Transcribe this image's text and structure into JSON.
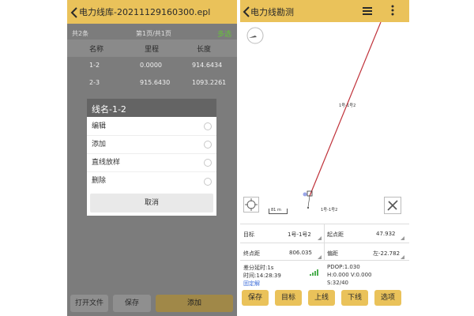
{
  "left": {
    "title": "电力线库-20211129160300.epl",
    "back_icon": "back-arrow-icon",
    "count_text": "共2条",
    "page_text": "第1页/共1页",
    "multi_select": "多选",
    "table": {
      "headers": [
        "名称",
        "里程",
        "长度"
      ],
      "rows": [
        [
          "1-2",
          "0.0000",
          "914.6434"
        ],
        [
          "2-3",
          "915.6430",
          "1093.2261"
        ]
      ]
    },
    "dialog": {
      "title": "线名-1-2",
      "options": [
        "编辑",
        "添加",
        "直线放样",
        "删除"
      ],
      "cancel": "取消"
    },
    "footer": {
      "open_file": "打开文件",
      "save": "保存",
      "add": "添加"
    }
  },
  "right": {
    "title": "电力线勘测",
    "icons": {
      "back": "back-arrow-icon",
      "layers": "layers-menu-icon",
      "more": "more-vertical-icon",
      "compass": "compass-icon",
      "locate": "locate-target-icon",
      "tools": "tools-icon"
    },
    "map": {
      "line_label": "1号-1号2",
      "point_label": "1号-1号2",
      "scale_label": "81 m"
    },
    "info": {
      "target_label": "目标",
      "target_value": "1号-1号2",
      "start_dist_label": "起点距",
      "start_dist_value": "47.932",
      "end_dist_label": "终点距",
      "end_dist_value": "806.035",
      "offset_label": "偏距",
      "offset_value": "左-22.782"
    },
    "status": {
      "diff_delay": "差分延时:1s",
      "time": "时间:14:28:39",
      "fix": "固定解",
      "pdop": "PDOP:1.030",
      "hv": "H:0.000  V:0.000",
      "sats": "S:32/40"
    },
    "toolbar": [
      "保存",
      "目标",
      "上线",
      "下线",
      "选项"
    ],
    "colors": {
      "accent": "#eac25a",
      "line": "#c0323a",
      "fix_text": "#3a6bd8"
    }
  }
}
